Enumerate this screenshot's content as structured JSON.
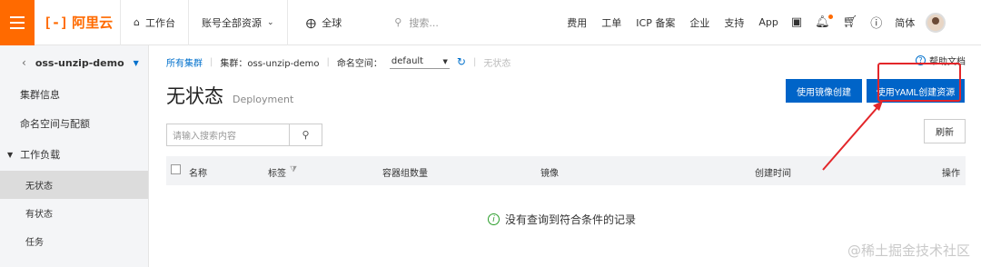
{
  "topbar": {
    "brand_mark": "[-]",
    "brand_text": "阿里云",
    "home_label": "工作台",
    "account_label": "账号全部资源",
    "region_label": "全球",
    "search_placeholder": "搜索...",
    "links": [
      "费用",
      "工单",
      "ICP 备案",
      "企业",
      "支持",
      "App"
    ],
    "lang_label": "简体"
  },
  "sidebar": {
    "cluster_name": "oss-unzip-demo",
    "items": [
      "集群信息",
      "命名空间与配额"
    ],
    "group_label": "工作负载",
    "sub_items": [
      "无状态",
      "有状态",
      "任务"
    ],
    "active_sub": "无状态"
  },
  "main": {
    "breadcrumb": {
      "all_clusters": "所有集群",
      "cluster": "集群：oss-unzip-demo",
      "namespace_label": "命名空间：",
      "namespace_value": "default",
      "current": "无状态"
    },
    "help_label": "帮助文档",
    "title": "无状态",
    "subtitle": "Deployment",
    "btn_mirror": "使用镜像创建",
    "btn_yaml": "使用YAML创建资源",
    "search_placeholder": "请输入搜索内容",
    "refresh_label": "刷新",
    "table_headers": {
      "name": "名称",
      "tags": "标签",
      "pods": "容器组数量",
      "image": "镜像",
      "created": "创建时间",
      "actions": "操作"
    },
    "empty_message": "没有查询到符合条件的记录"
  },
  "watermark": "@稀土掘金技术社区",
  "colors": {
    "brand_orange": "#ff6a00",
    "primary_blue": "#0064c8",
    "annotation_red": "#e3262a"
  }
}
